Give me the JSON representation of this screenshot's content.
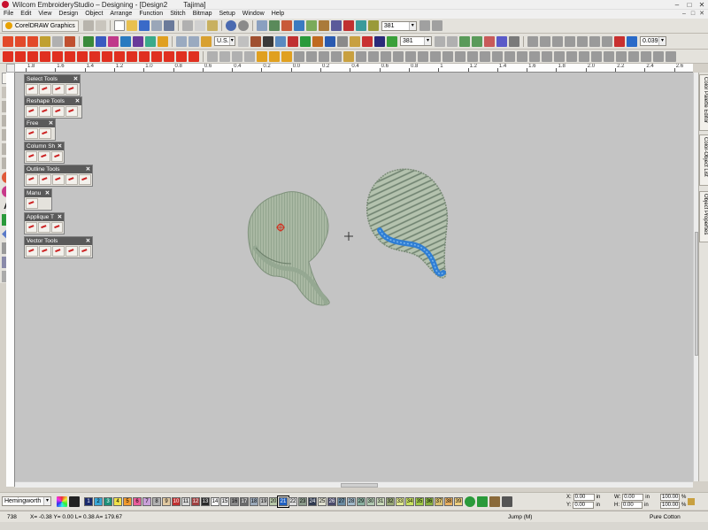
{
  "window": {
    "title": "Wilcom EmbroideryStudio – Designing - [Design2",
    "machine": "Tajima]",
    "controls": [
      "–",
      "□",
      "✕"
    ]
  },
  "menu": [
    "File",
    "Edit",
    "View",
    "Design",
    "Object",
    "Arrange",
    "Function",
    "Stitch",
    "Bitmap",
    "Setup",
    "Window",
    "Help"
  ],
  "mdi_controls": [
    "–",
    "□",
    "✕"
  ],
  "toolbar1": {
    "corel_label": "CorelDRAW Graphics",
    "stitch_count": "381"
  },
  "toolbar2": {
    "unit": "U.S.",
    "stitch_value": "381",
    "thickness": "0.039"
  },
  "ruler_labels": [
    "1.8",
    "1.6",
    "1.4",
    "1.2",
    "1.0",
    "0.8",
    "0.6",
    "0.4",
    "0.2",
    "0.0",
    "0.2",
    "0.4",
    "0.6",
    "0.8",
    "1",
    "1.2",
    "1.4",
    "1.6",
    "1.8",
    "2.0",
    "2.2",
    "2.4",
    "2.6"
  ],
  "panels": [
    {
      "title": "Select Tools",
      "icons": 4
    },
    {
      "title": "Reshape Tools",
      "icons": 4
    },
    {
      "title": "Free",
      "icons": 2
    },
    {
      "title": "Column Sh",
      "icons": 3
    },
    {
      "title": "Outline Tools",
      "icons": 5
    },
    {
      "title": "Manu",
      "icons": 2
    },
    {
      "title": "Applique T",
      "icons": 3
    },
    {
      "title": "Vector Tools",
      "icons": 5
    }
  ],
  "dockers": [
    "Color Palette Editor",
    "Color-Object List",
    "Object Properties"
  ],
  "palette": {
    "thread_chart": "Hemingworth",
    "swatches": [
      {
        "n": "1",
        "c": "#1a2a6c"
      },
      {
        "n": "2",
        "c": "#3aa7d6"
      },
      {
        "n": "3",
        "c": "#1d8f7a"
      },
      {
        "n": "4",
        "c": "#f0e04a"
      },
      {
        "n": "5",
        "c": "#f29a2e"
      },
      {
        "n": "6",
        "c": "#e85c9a"
      },
      {
        "n": "7",
        "c": "#c8a0d8"
      },
      {
        "n": "8",
        "c": "#b0b0b0"
      },
      {
        "n": "9",
        "c": "#e0c8a0"
      },
      {
        "n": "10",
        "c": "#c03030"
      },
      {
        "n": "11",
        "c": "#d8d8d8"
      },
      {
        "n": "12",
        "c": "#a04040"
      },
      {
        "n": "13",
        "c": "#2a2a2a"
      },
      {
        "n": "14",
        "c": "#f8f8f8"
      },
      {
        "n": "15",
        "c": "#e8e8e8"
      },
      {
        "n": "16",
        "c": "#8a8a8a"
      },
      {
        "n": "17",
        "c": "#6a6a6a"
      },
      {
        "n": "18",
        "c": "#9aa8b8"
      },
      {
        "n": "19",
        "c": "#c0c0c0"
      },
      {
        "n": "20",
        "c": "#b8c8a8"
      },
      {
        "n": "21",
        "c": "#2060c0"
      },
      {
        "n": "22",
        "c": "#dcdcdc"
      },
      {
        "n": "23",
        "c": "#8a9a8a"
      },
      {
        "n": "24",
        "c": "#303a50"
      },
      {
        "n": "25",
        "c": "#e0e0d0"
      },
      {
        "n": "26",
        "c": "#4a4a6a"
      },
      {
        "n": "27",
        "c": "#6a8aa0"
      },
      {
        "n": "28",
        "c": "#a0b8c8"
      },
      {
        "n": "29",
        "c": "#8ab0a0"
      },
      {
        "n": "30",
        "c": "#b0c8b0"
      },
      {
        "n": "31",
        "c": "#c8d8b8"
      },
      {
        "n": "32",
        "c": "#98a878"
      },
      {
        "n": "33",
        "c": "#e0e890"
      },
      {
        "n": "34",
        "c": "#c8e060"
      },
      {
        "n": "35",
        "c": "#a0c848"
      },
      {
        "n": "36",
        "c": "#88b040"
      },
      {
        "n": "37",
        "c": "#d8c070"
      },
      {
        "n": "38",
        "c": "#e8b060"
      },
      {
        "n": "39",
        "c": "#f0d080"
      }
    ]
  },
  "coords": {
    "x_label": "X:",
    "x_value": "0.00",
    "x_unit": "in",
    "y_label": "Y:",
    "y_value": "0.00",
    "y_unit": "in",
    "w_label": "W:",
    "w_value": "0.00",
    "w_unit": "in",
    "h_label": "H:",
    "h_value": "0.00",
    "h_unit": "in",
    "sx_value": "100.00",
    "sy_value": "100.00",
    "pct_unit": "%"
  },
  "status": {
    "count": "738",
    "position": "X= -0.38 Y= 0.00 L= 0.38 A= 179.67",
    "hint": "Jump (M)",
    "fabric": "Pure Cotton"
  },
  "colors": {
    "canvas": "#c4c4c4",
    "fill_thread": "#a9b8a3",
    "accent_thread": "#2f7ed4",
    "panel_header": "#5a5a5a"
  }
}
